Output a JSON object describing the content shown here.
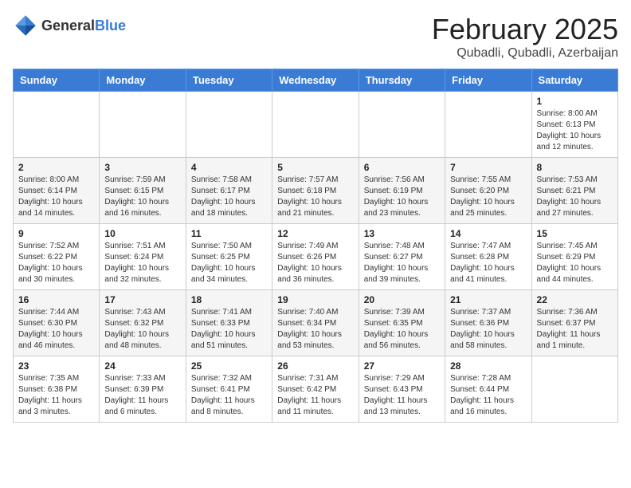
{
  "header": {
    "logo": {
      "general": "General",
      "blue": "Blue"
    },
    "title": "February 2025",
    "location": "Qubadli, Qubadli, Azerbaijan"
  },
  "calendar": {
    "days_of_week": [
      "Sunday",
      "Monday",
      "Tuesday",
      "Wednesday",
      "Thursday",
      "Friday",
      "Saturday"
    ],
    "weeks": [
      [
        {
          "day": "",
          "info": ""
        },
        {
          "day": "",
          "info": ""
        },
        {
          "day": "",
          "info": ""
        },
        {
          "day": "",
          "info": ""
        },
        {
          "day": "",
          "info": ""
        },
        {
          "day": "",
          "info": ""
        },
        {
          "day": "1",
          "info": "Sunrise: 8:00 AM\nSunset: 6:13 PM\nDaylight: 10 hours\nand 12 minutes."
        }
      ],
      [
        {
          "day": "2",
          "info": "Sunrise: 8:00 AM\nSunset: 6:14 PM\nDaylight: 10 hours\nand 14 minutes."
        },
        {
          "day": "3",
          "info": "Sunrise: 7:59 AM\nSunset: 6:15 PM\nDaylight: 10 hours\nand 16 minutes."
        },
        {
          "day": "4",
          "info": "Sunrise: 7:58 AM\nSunset: 6:17 PM\nDaylight: 10 hours\nand 18 minutes."
        },
        {
          "day": "5",
          "info": "Sunrise: 7:57 AM\nSunset: 6:18 PM\nDaylight: 10 hours\nand 21 minutes."
        },
        {
          "day": "6",
          "info": "Sunrise: 7:56 AM\nSunset: 6:19 PM\nDaylight: 10 hours\nand 23 minutes."
        },
        {
          "day": "7",
          "info": "Sunrise: 7:55 AM\nSunset: 6:20 PM\nDaylight: 10 hours\nand 25 minutes."
        },
        {
          "day": "8",
          "info": "Sunrise: 7:53 AM\nSunset: 6:21 PM\nDaylight: 10 hours\nand 27 minutes."
        }
      ],
      [
        {
          "day": "9",
          "info": "Sunrise: 7:52 AM\nSunset: 6:22 PM\nDaylight: 10 hours\nand 30 minutes."
        },
        {
          "day": "10",
          "info": "Sunrise: 7:51 AM\nSunset: 6:24 PM\nDaylight: 10 hours\nand 32 minutes."
        },
        {
          "day": "11",
          "info": "Sunrise: 7:50 AM\nSunset: 6:25 PM\nDaylight: 10 hours\nand 34 minutes."
        },
        {
          "day": "12",
          "info": "Sunrise: 7:49 AM\nSunset: 6:26 PM\nDaylight: 10 hours\nand 36 minutes."
        },
        {
          "day": "13",
          "info": "Sunrise: 7:48 AM\nSunset: 6:27 PM\nDaylight: 10 hours\nand 39 minutes."
        },
        {
          "day": "14",
          "info": "Sunrise: 7:47 AM\nSunset: 6:28 PM\nDaylight: 10 hours\nand 41 minutes."
        },
        {
          "day": "15",
          "info": "Sunrise: 7:45 AM\nSunset: 6:29 PM\nDaylight: 10 hours\nand 44 minutes."
        }
      ],
      [
        {
          "day": "16",
          "info": "Sunrise: 7:44 AM\nSunset: 6:30 PM\nDaylight: 10 hours\nand 46 minutes."
        },
        {
          "day": "17",
          "info": "Sunrise: 7:43 AM\nSunset: 6:32 PM\nDaylight: 10 hours\nand 48 minutes."
        },
        {
          "day": "18",
          "info": "Sunrise: 7:41 AM\nSunset: 6:33 PM\nDaylight: 10 hours\nand 51 minutes."
        },
        {
          "day": "19",
          "info": "Sunrise: 7:40 AM\nSunset: 6:34 PM\nDaylight: 10 hours\nand 53 minutes."
        },
        {
          "day": "20",
          "info": "Sunrise: 7:39 AM\nSunset: 6:35 PM\nDaylight: 10 hours\nand 56 minutes."
        },
        {
          "day": "21",
          "info": "Sunrise: 7:37 AM\nSunset: 6:36 PM\nDaylight: 10 hours\nand 58 minutes."
        },
        {
          "day": "22",
          "info": "Sunrise: 7:36 AM\nSunset: 6:37 PM\nDaylight: 11 hours\nand 1 minute."
        }
      ],
      [
        {
          "day": "23",
          "info": "Sunrise: 7:35 AM\nSunset: 6:38 PM\nDaylight: 11 hours\nand 3 minutes."
        },
        {
          "day": "24",
          "info": "Sunrise: 7:33 AM\nSunset: 6:39 PM\nDaylight: 11 hours\nand 6 minutes."
        },
        {
          "day": "25",
          "info": "Sunrise: 7:32 AM\nSunset: 6:41 PM\nDaylight: 11 hours\nand 8 minutes."
        },
        {
          "day": "26",
          "info": "Sunrise: 7:31 AM\nSunset: 6:42 PM\nDaylight: 11 hours\nand 11 minutes."
        },
        {
          "day": "27",
          "info": "Sunrise: 7:29 AM\nSunset: 6:43 PM\nDaylight: 11 hours\nand 13 minutes."
        },
        {
          "day": "28",
          "info": "Sunrise: 7:28 AM\nSunset: 6:44 PM\nDaylight: 11 hours\nand 16 minutes."
        },
        {
          "day": "",
          "info": ""
        }
      ]
    ]
  }
}
